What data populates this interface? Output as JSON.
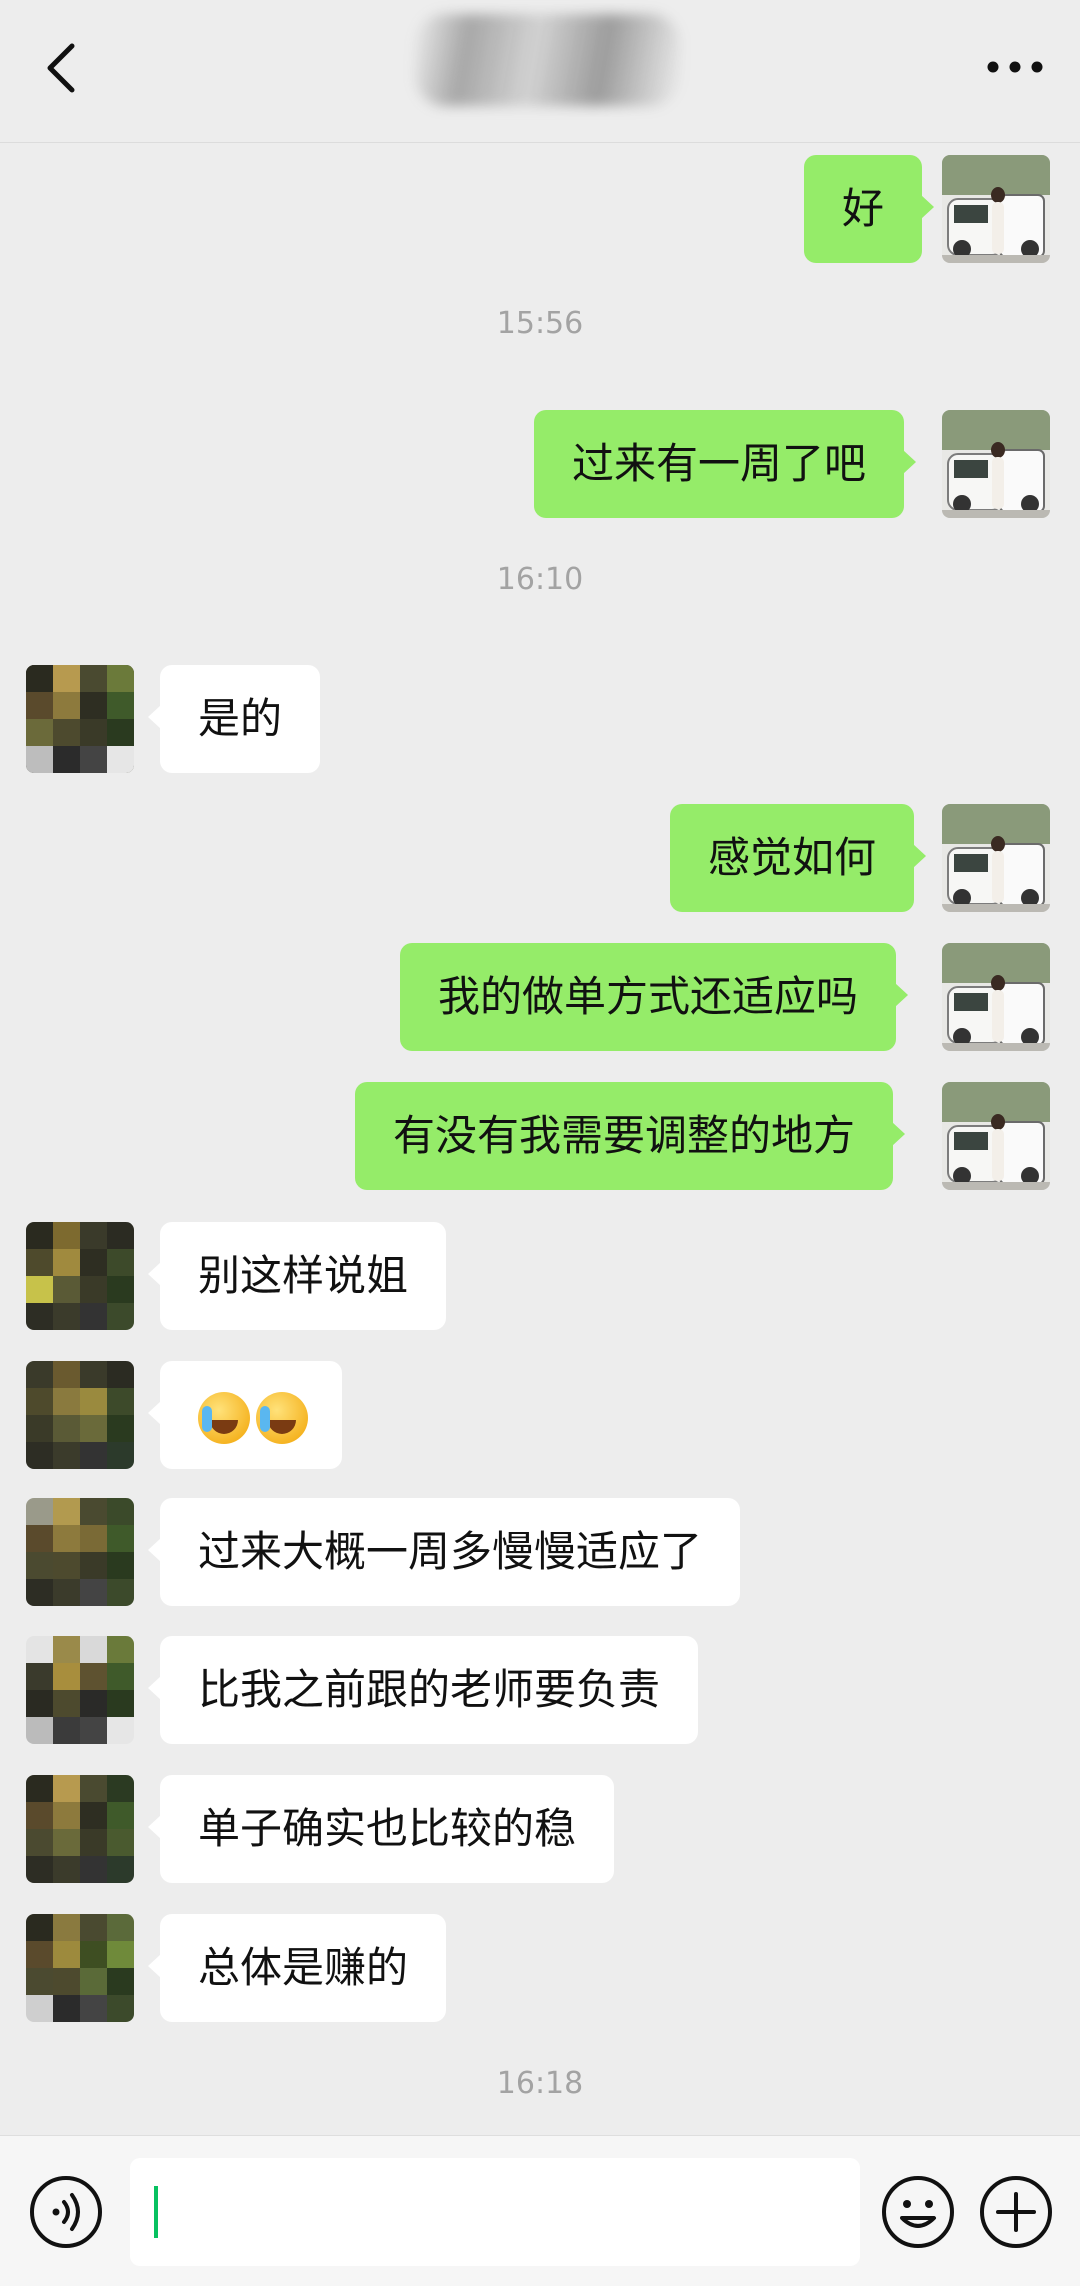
{
  "header": {
    "title": "",
    "back_icon": "chevron-left-icon",
    "more_icon": "more-dots-icon"
  },
  "messages": [
    {
      "side": "me",
      "text": "好"
    },
    {
      "type": "timestamp",
      "text": "15:56"
    },
    {
      "side": "me",
      "text": "过来有一周了吧"
    },
    {
      "type": "timestamp",
      "text": "16:10"
    },
    {
      "side": "them",
      "text": "是的"
    },
    {
      "side": "me",
      "text": "感觉如何"
    },
    {
      "side": "me",
      "text": "我的做单方式还适应吗"
    },
    {
      "side": "me",
      "text": "有没有我需要调整的地方"
    },
    {
      "side": "them",
      "text": "别这样说姐"
    },
    {
      "side": "them",
      "emoji": "loudly-crying-face-icon x2"
    },
    {
      "side": "them",
      "text": "过来大概一周多慢慢适应了"
    },
    {
      "side": "them",
      "text": "比我之前跟的老师要负责"
    },
    {
      "side": "them",
      "text": "单子确实也比较的稳"
    },
    {
      "side": "them",
      "text": "总体是赚的"
    },
    {
      "type": "timestamp",
      "text": "16:18"
    }
  ],
  "input_bar": {
    "voice_icon": "voice-icon",
    "input_value": "",
    "emoji_icon": "smiley-icon",
    "plus_icon": "plus-icon"
  },
  "colors": {
    "background": "#ededed",
    "my_bubble": "#95ec69",
    "their_bubble": "#ffffff",
    "caret": "#07c160"
  }
}
